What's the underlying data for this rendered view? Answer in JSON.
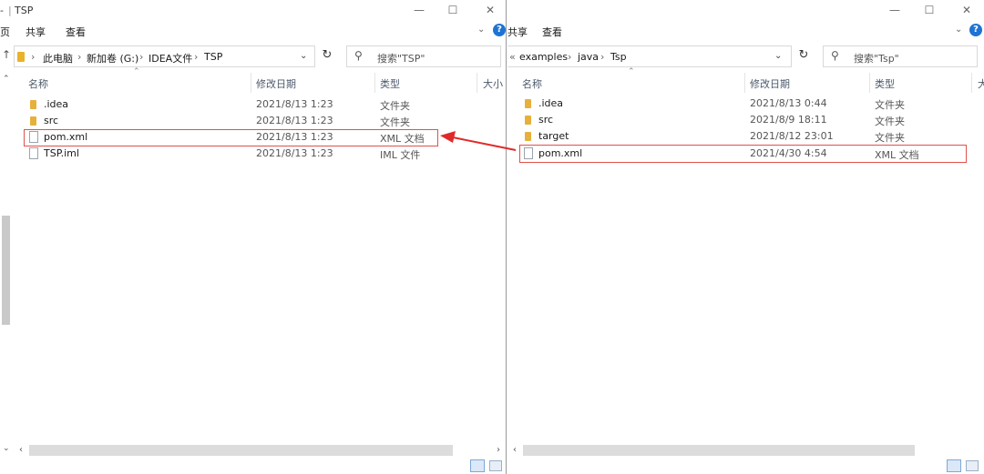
{
  "left": {
    "title": "TSP",
    "title_prefix": "-",
    "ribbon_cut": "页",
    "ribbon": [
      "共享",
      "查看"
    ],
    "breadcrumb": [
      "此电脑",
      "新加卷 (G:)",
      "IDEA文件",
      "TSP"
    ],
    "search_placeholder": "搜索\"TSP\"",
    "columns": [
      "名称",
      "修改日期",
      "类型",
      "大小"
    ],
    "rows": [
      {
        "name": ".idea",
        "date": "2021/8/13 1:23",
        "type": "文件夹",
        "icon": "folder-icon"
      },
      {
        "name": "src",
        "date": "2021/8/13 1:23",
        "type": "文件夹",
        "icon": "folder-icon"
      },
      {
        "name": "pom.xml",
        "date": "2021/8/13 1:23",
        "type": "XML 文档",
        "icon": "file-icon"
      },
      {
        "name": "TSP.iml",
        "date": "2021/8/13 1:23",
        "type": "IML 文件",
        "icon": "file-icon"
      }
    ]
  },
  "right": {
    "ribbon": [
      "共享",
      "查看"
    ],
    "ribbon_cut": "共享",
    "breadcrumb": [
      "examples",
      "java",
      "Tsp"
    ],
    "search_placeholder": "搜索\"Tsp\"",
    "columns": [
      "名称",
      "修改日期",
      "类型",
      "大"
    ],
    "rows": [
      {
        "name": ".idea",
        "date": "2021/8/13 0:44",
        "type": "文件夹",
        "icon": "folder-icon"
      },
      {
        "name": "src",
        "date": "2021/8/9 18:11",
        "type": "文件夹",
        "icon": "folder-icon"
      },
      {
        "name": "target",
        "date": "2021/8/12 23:01",
        "type": "文件夹",
        "icon": "folder-icon"
      },
      {
        "name": "pom.xml",
        "date": "2021/4/30 4:54",
        "type": "XML 文档",
        "icon": "file-icon"
      }
    ]
  },
  "colors": {
    "highlight": "#e0514b",
    "arrow": "#e02a2a",
    "help": "#1e73d4"
  }
}
